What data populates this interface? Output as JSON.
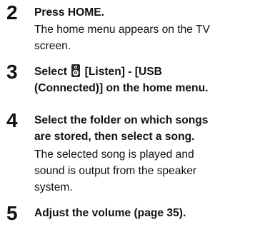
{
  "steps": [
    {
      "number": "2",
      "title": "Press HOME.",
      "description": [
        "The home menu appears on the TV",
        "screen."
      ]
    },
    {
      "number": "3",
      "title_before_icon": "Select",
      "title_icon": "speaker-icon",
      "title_after_icon": "[Listen] - [USB",
      "title_line2": "(Connected)] on the home menu."
    },
    {
      "number": "4",
      "title": [
        "Select the folder on which songs",
        "are stored, then select a song."
      ],
      "description": [
        "The selected song is played and",
        "sound is output from the speaker",
        "system."
      ]
    },
    {
      "number": "5",
      "title": "Adjust the volume (page 35)."
    }
  ]
}
